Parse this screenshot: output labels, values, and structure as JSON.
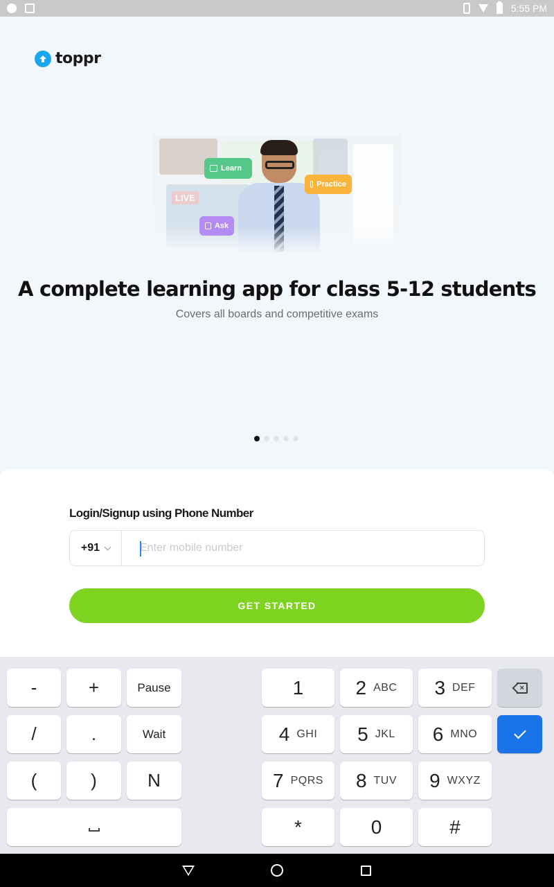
{
  "status_bar": {
    "time": "5:55 PM"
  },
  "app": {
    "logo_text": "toppr"
  },
  "hero": {
    "chips": {
      "learn": "Learn",
      "practice": "Practice",
      "ask": "Ask"
    },
    "live_tag": "LIVE"
  },
  "headline": "A complete learning app for class 5-12 students",
  "subheadline": "Covers all boards and competitive exams",
  "carousel": {
    "total": 5,
    "active_index": 0
  },
  "login": {
    "label": "Login/Signup using Phone Number",
    "country_code": "+91",
    "phone_placeholder": "Enter mobile number",
    "phone_value": "",
    "cta_label": "GET STARTED"
  },
  "keyboard": {
    "symbols": {
      "minus": "-",
      "plus": "+",
      "slash": "/",
      "dot": ".",
      "lparen": "(",
      "rparen": ")",
      "n": "N"
    },
    "pause": "Pause",
    "wait": "Wait",
    "digits": [
      {
        "digit": "1",
        "letters": ""
      },
      {
        "digit": "2",
        "letters": "ABC"
      },
      {
        "digit": "3",
        "letters": "DEF"
      },
      {
        "digit": "4",
        "letters": "GHI"
      },
      {
        "digit": "5",
        "letters": "JKL"
      },
      {
        "digit": "6",
        "letters": "MNO"
      },
      {
        "digit": "7",
        "letters": "PQRS"
      },
      {
        "digit": "8",
        "letters": "TUV"
      },
      {
        "digit": "9",
        "letters": "WXYZ"
      },
      {
        "digit": "*",
        "letters": ""
      },
      {
        "digit": "0",
        "letters": ""
      },
      {
        "digit": "#",
        "letters": ""
      }
    ],
    "backspace_icon": "backspace-icon",
    "done_icon": "check-icon",
    "space_icon": "space-icon"
  },
  "nav_bar": {
    "back": "back-icon",
    "home": "home-icon",
    "recents": "recents-icon"
  },
  "colors": {
    "brand": "#1aa5ef",
    "cta": "#7ed321",
    "done_key": "#1a73e8",
    "learn": "#56c98a",
    "practice": "#f9b43c",
    "ask": "#b48bf2"
  }
}
